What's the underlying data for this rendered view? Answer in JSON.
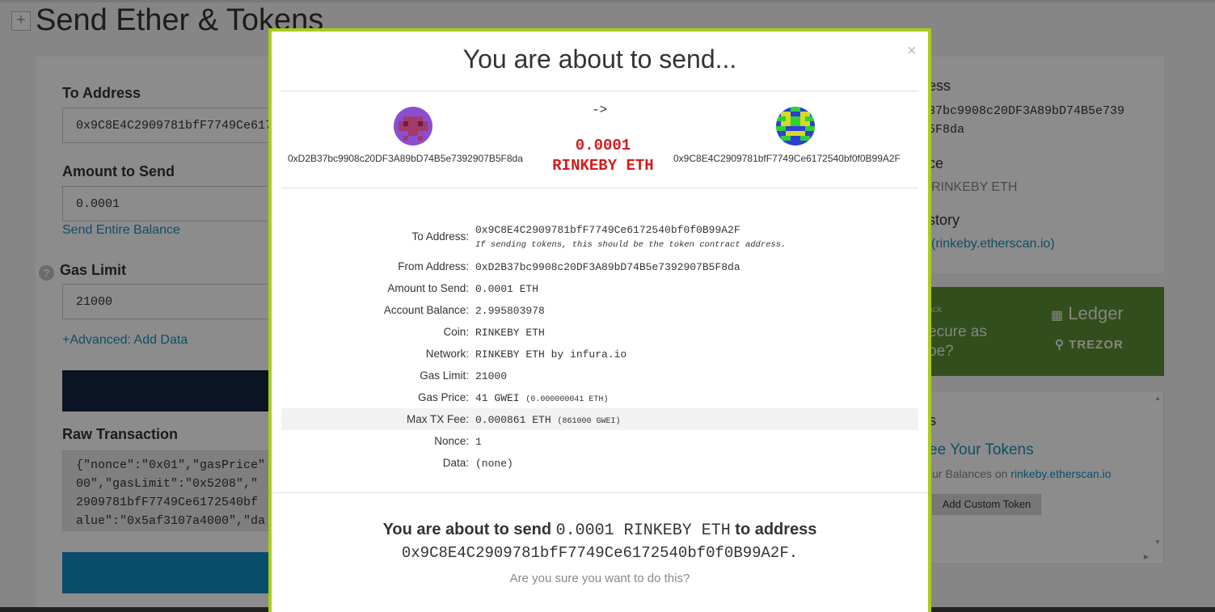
{
  "page": {
    "title": "Send Ether & Tokens",
    "expand_symbol": "+"
  },
  "form": {
    "to_label": "To Address",
    "to_value": "0x9C8E4C2909781bfF7749Ce6172540bf0f0B99A2F",
    "amount_label": "Amount to Send",
    "amount_value": "0.0001",
    "send_entire_balance": "Send Entire Balance",
    "gas_label": "Gas Limit",
    "gas_help": "?",
    "gas_value": "21000",
    "advanced_link": "+Advanced: Add Data",
    "raw_label": "Raw Transaction",
    "raw_lines": [
      "{\"nonce\":\"0x01\",\"gasPrice\"",
      "00\",\"gasLimit\":\"0x5208\",\"",
      "2909781bfF7749Ce6172540bf",
      "alue\":\"0x5af3107a4000\",\"da"
    ]
  },
  "sidebar": {
    "address_label": "ess",
    "address_line1": "37bc9908c20DF3A89bD74B5e739",
    "address_line2": "5F8da",
    "balance_label": "ce",
    "balance_value": "RINKEBY ETH",
    "history_label": "story",
    "history_link": "(rinkeby.etherscan.io)",
    "promo_small": "ack",
    "promo_line1": "ecure as",
    "promo_line2": "be?",
    "ledger": "Ledger",
    "trezor": "TREZOR",
    "tokens_heading": "s",
    "tokens_title": "ee Your Tokens",
    "tokens_line_prefix": "ur Balances on ",
    "tokens_line_link": "rinkeby.etherscan.io",
    "add_custom_token": "Add Custom Token"
  },
  "modal": {
    "title": "You are about to send...",
    "close": "×",
    "from_address": "0xD2B37bc9908c20DF3A89bD74B5e7392907B5F8da",
    "to_address": "0x9C8E4C2909781bfF7749Ce6172540bf0f0B99A2F",
    "arrow": "->",
    "amount": "0.0001",
    "currency": "RINKEBY ETH",
    "details": {
      "to_label": "To Address:",
      "to_value": "0x9C8E4C2909781bfF7749Ce6172540bf0f0B99A2F",
      "to_hint": "If sending tokens, this should be the token contract address.",
      "from_label": "From Address:",
      "from_value": "0xD2B37bc9908c20DF3A89bD74B5e7392907B5F8da",
      "amount_label": "Amount to Send:",
      "amount_value": "0.0001 ETH",
      "balance_label": "Account Balance:",
      "balance_value": "2.995803978",
      "coin_label": "Coin:",
      "coin_value": "RINKEBY ETH",
      "network_label": "Network:",
      "network_value": "RINKEBY ETH by infura.io",
      "gaslimit_label": "Gas Limit:",
      "gaslimit_value": "21000",
      "gasprice_label": "Gas Price:",
      "gasprice_value": "41 GWEI",
      "gasprice_sub": "(0.000000041 ETH)",
      "maxfee_label": "Max TX Fee:",
      "maxfee_value": "0.000861 ETH",
      "maxfee_sub": "(861000 GWEI)",
      "nonce_label": "Nonce:",
      "nonce_value": "1",
      "data_label": "Data:",
      "data_value": "(none)"
    },
    "confirm_prefix": "You are about to send",
    "confirm_amount": "0.0001 RINKEBY ETH",
    "confirm_mid": "to address",
    "confirm_address": "0x9C8E4C2909781bfF7749Ce6172540bf0f0B99A2F.",
    "confirm_question": "Are you sure you want to do this?"
  },
  "colors": {
    "modal_border": "#a9cc1e",
    "amount_red": "#d41b1b",
    "link_blue": "#1a8fc0",
    "promo_green": "#5b8e33",
    "dark_button": "#14253f"
  }
}
